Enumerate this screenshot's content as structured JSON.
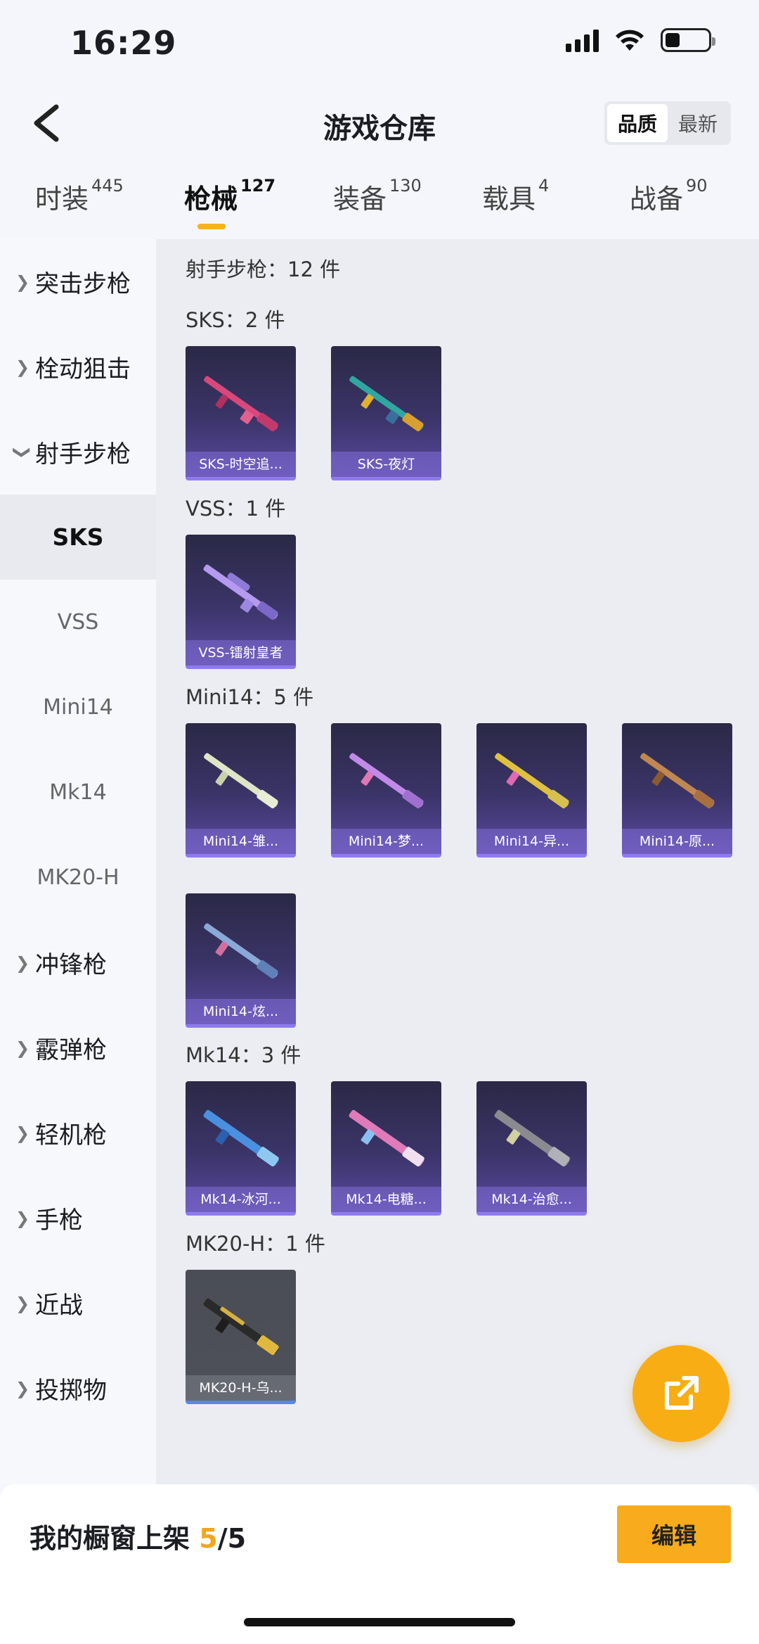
{
  "status_bar": {
    "time": "16:29"
  },
  "header": {
    "title": "游戏仓库",
    "sort_options": [
      {
        "label": "品质",
        "active": true
      },
      {
        "label": "最新",
        "active": false
      }
    ]
  },
  "tabs": [
    {
      "label": "时装",
      "count": "445",
      "active": false
    },
    {
      "label": "枪械",
      "count": "127",
      "active": true
    },
    {
      "label": "装备",
      "count": "130",
      "active": false
    },
    {
      "label": "载具",
      "count": "4",
      "active": false
    },
    {
      "label": "战备",
      "count": "90",
      "active": false
    }
  ],
  "sidebar": {
    "items": [
      {
        "label": "突击步枪",
        "type": "category",
        "expanded": false
      },
      {
        "label": "栓动狙击",
        "type": "category",
        "expanded": false
      },
      {
        "label": "射手步枪",
        "type": "category",
        "expanded": true
      },
      {
        "label": "SKS",
        "type": "sub",
        "active": true
      },
      {
        "label": "VSS",
        "type": "sub",
        "active": false
      },
      {
        "label": "Mini14",
        "type": "sub",
        "active": false
      },
      {
        "label": "Mk14",
        "type": "sub",
        "active": false
      },
      {
        "label": "MK20-H",
        "type": "sub",
        "active": false
      },
      {
        "label": "冲锋枪",
        "type": "category",
        "expanded": false
      },
      {
        "label": "霰弹枪",
        "type": "category",
        "expanded": false
      },
      {
        "label": "轻机枪",
        "type": "category",
        "expanded": false
      },
      {
        "label": "手枪",
        "type": "category",
        "expanded": false
      },
      {
        "label": "近战",
        "type": "category",
        "expanded": false
      },
      {
        "label": "投掷物",
        "type": "category",
        "expanded": false
      }
    ]
  },
  "main": {
    "total_label": "射手步枪：12 件",
    "groups": [
      {
        "label": "SKS：2 件",
        "items": [
          "SKS-时空追...",
          "SKS-夜灯"
        ]
      },
      {
        "label": "VSS：1 件",
        "items": [
          "VSS-镭射皇者"
        ]
      },
      {
        "label": "Mini14：5 件",
        "items": [
          "Mini14-雏...",
          "Mini14-梦...",
          "Mini14-异...",
          "Mini14-原...",
          "Mini14-炫..."
        ]
      },
      {
        "label": "Mk14：3 件",
        "items": [
          "Mk14-冰河...",
          "Mk14-电糖...",
          "Mk14-治愈..."
        ]
      },
      {
        "label": "MK20-H：1 件",
        "items": [
          "MK20-H-乌..."
        ]
      }
    ]
  },
  "bottom_bar": {
    "showcase_label": "我的橱窗上架",
    "showcase_used": "5",
    "showcase_total": "/5",
    "edit_label": "编辑"
  },
  "colors": {
    "accent": "#f7ab1d",
    "card_purple": "#3b3468",
    "card_gray": "#4e5159"
  },
  "icons": [
    "signal-icon",
    "wifi-icon",
    "battery-icon",
    "back-arrow-icon",
    "chevron-right-icon",
    "chevron-down-icon",
    "share-icon",
    "rifle-icon"
  ]
}
